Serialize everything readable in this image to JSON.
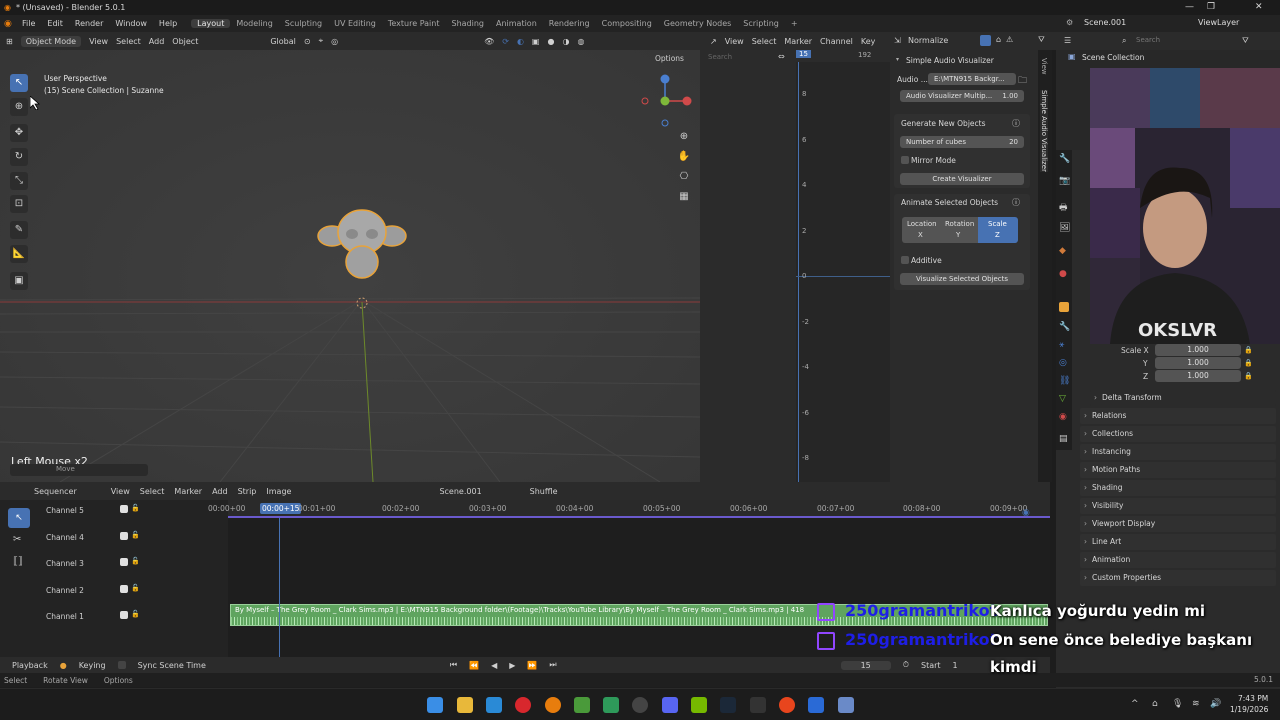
{
  "window": {
    "title": "* (Unsaved) - Blender 5.0.1",
    "controls": [
      "—",
      "❐",
      "✕"
    ]
  },
  "menu": {
    "items": [
      "File",
      "Edit",
      "Render",
      "Window",
      "Help"
    ],
    "workspaces": [
      "Layout",
      "Modeling",
      "Sculpting",
      "UV Editing",
      "Texture Paint",
      "Shading",
      "Animation",
      "Rendering",
      "Compositing",
      "Geometry Nodes",
      "Scripting"
    ],
    "active_workspace": "Layout",
    "add_tab": "+"
  },
  "top_right": {
    "scene": "Scene.001",
    "view_layer": "ViewLayer"
  },
  "viewport": {
    "mode": "Object Mode",
    "menus": [
      "View",
      "Select",
      "Add",
      "Object"
    ],
    "orientation": "Global",
    "options_label": "Options",
    "perspective_label": "User Perspective",
    "context_label": "(15) Scene Collection | Suzanne",
    "operator_label": "Left Mouse x2",
    "operator_sub": "Move"
  },
  "graph_editor": {
    "menus": [
      "View",
      "Select",
      "Marker",
      "Channel",
      "Key"
    ],
    "normalize_label": "Normalize",
    "search_placeholder": "Search",
    "current_frame": "15",
    "end_frame": "192",
    "y_ticks": [
      "8",
      "6",
      "4",
      "2",
      "0",
      "-2",
      "-4",
      "-6",
      "-8"
    ]
  },
  "npanel": {
    "title": "Simple Audio Visualizer",
    "audio_label": "Audio ...",
    "audio_path": "E:\\MTN915 Backgr...",
    "multiplier_label": "Audio Visualizer Multip...",
    "multiplier_value": "1.00",
    "generate_title": "Generate New Objects",
    "cubes_label": "Number of cubes",
    "cubes_value": "20",
    "mirror_label": "Mirror Mode",
    "create_button": "Create Visualizer",
    "animate_title": "Animate Selected Objects",
    "location_label": "Location",
    "location_axis": "X",
    "rotation_label": "Rotation",
    "rotation_axis": "Y",
    "scale_label": "Scale",
    "scale_axis": "Z",
    "additive_label": "Additive",
    "visualize_button": "Visualize Selected Objects",
    "tabs": [
      "View",
      "Simple Audio Visualizer"
    ]
  },
  "outliner": {
    "search_placeholder": "Search",
    "root": "Scene Collection"
  },
  "properties": {
    "scale_x_label": "Scale X",
    "scale_x": "1.000",
    "scale_y_label": "Y",
    "scale_y": "1.000",
    "scale_z_label": "Z",
    "scale_z": "1.000",
    "delta_transform": "Delta Transform",
    "sections": [
      "Relations",
      "Collections",
      "Instancing",
      "Motion Paths",
      "Shading",
      "Visibility",
      "Viewport Display",
      "Line Art",
      "Animation",
      "Custom Properties"
    ]
  },
  "sequencer": {
    "editor": "Sequencer",
    "menus": [
      "View",
      "Select",
      "Marker",
      "Add",
      "Strip",
      "Image"
    ],
    "scene": "Scene.001",
    "shuffle": "Shuffle",
    "channels": [
      "Channel 5",
      "Channel 4",
      "Channel 3",
      "Channel 2",
      "Channel 1"
    ],
    "ticks": [
      "00:00+00",
      "00:00+15",
      "00:01+00",
      "00:02+00",
      "00:03+00",
      "00:04+00",
      "00:05+00",
      "00:06+00",
      "00:07+00",
      "00:08+00",
      "00:09+00"
    ],
    "strip_text": "By Myself – The Grey Room _ Clark Sims.mp3 | E:\\MTN915 Background folder\\(Footage)\\Tracks\\YouTube Library\\By Myself – The Grey Room _ Clark Sims.mp3 | 418"
  },
  "timeline": {
    "playback": "Playback",
    "keying": "Keying",
    "sync": "Sync Scene Time",
    "current_frame": "15",
    "start_label": "Start",
    "start_value": "1"
  },
  "statusbar": {
    "items": [
      "Select",
      "Rotate View",
      "Options"
    ],
    "version": "5.0.1"
  },
  "taskbar": {
    "time": "7:43 PM",
    "date": "1/19/2026"
  },
  "chat": [
    {
      "user": "250gramantrikot",
      "message": "Kanlıca yoğurdu yedin mi"
    },
    {
      "user": "250gramantrikot",
      "message": "On sene önce belediye başkanı",
      "message_cont": "kimdi"
    }
  ],
  "colors": {
    "accent": "#4772b3",
    "strip": "#5fa45f",
    "selection_orange": "#e8a33a",
    "chat_user": "#1e1ee6",
    "twitch": "#9146ff"
  }
}
